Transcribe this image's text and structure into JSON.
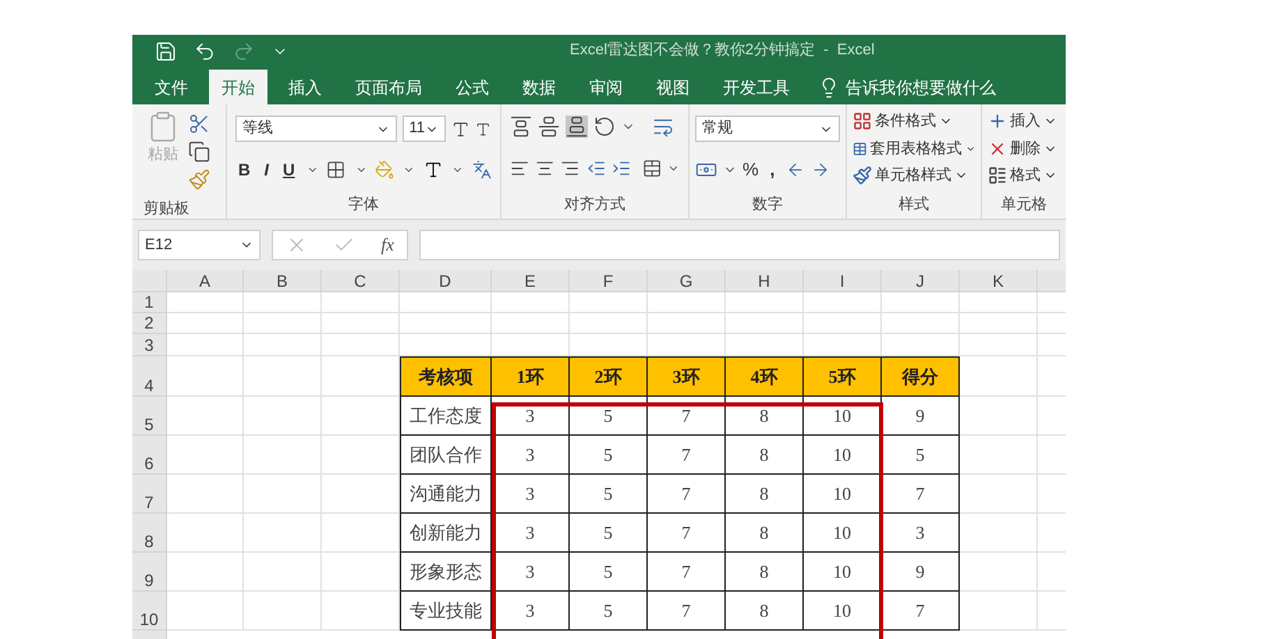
{
  "window": {
    "title": "Excel雷达图不会做？教你2分钟搞定  -  Excel"
  },
  "tabs": [
    {
      "label": "文件",
      "selected": false
    },
    {
      "label": "开始",
      "selected": true
    },
    {
      "label": "插入",
      "selected": false
    },
    {
      "label": "页面布局",
      "selected": false
    },
    {
      "label": "公式",
      "selected": false
    },
    {
      "label": "数据",
      "selected": false
    },
    {
      "label": "审阅",
      "selected": false
    },
    {
      "label": "视图",
      "selected": false
    },
    {
      "label": "开发工具",
      "selected": false
    }
  ],
  "tell_me": "告诉我你想要做什么",
  "ribbon": {
    "clipboard": {
      "label": "剪贴板",
      "paste": "粘贴",
      "paste_disabled": true
    },
    "font": {
      "label": "字体",
      "font_name": "等线",
      "font_size": "11",
      "bold": "B",
      "italic": "I",
      "underline": "U"
    },
    "alignment": {
      "label": "对齐方式"
    },
    "number": {
      "label": "数字",
      "format": "常规",
      "percent": "%",
      "comma": ","
    },
    "styles": {
      "label": "样式",
      "buttons": [
        "条件格式",
        "套用表格格式",
        "单元格样式"
      ]
    },
    "cells": {
      "label": "单元格",
      "buttons": [
        "插入",
        "删除",
        "格式"
      ]
    }
  },
  "formula_bar": {
    "name_box": "E12",
    "fx": "fx"
  },
  "sheet": {
    "columns": [
      "A",
      "B",
      "C",
      "D",
      "E",
      "F",
      "G",
      "H",
      "I",
      "J",
      "K"
    ],
    "rows": [
      "1",
      "2",
      "3",
      "4",
      "5",
      "6",
      "7",
      "8",
      "9",
      "10"
    ],
    "table": {
      "header": [
        "考核项",
        "1环",
        "2环",
        "3环",
        "4环",
        "5环",
        "得分"
      ],
      "rows": [
        [
          "工作态度",
          "3",
          "5",
          "7",
          "8",
          "10",
          "9"
        ],
        [
          "团队合作",
          "3",
          "5",
          "7",
          "8",
          "10",
          "5"
        ],
        [
          "沟通能力",
          "3",
          "5",
          "7",
          "8",
          "10",
          "7"
        ],
        [
          "创新能力",
          "3",
          "5",
          "7",
          "8",
          "10",
          "3"
        ],
        [
          "形象形态",
          "3",
          "5",
          "7",
          "8",
          "10",
          "9"
        ],
        [
          "专业技能",
          "3",
          "5",
          "7",
          "8",
          "10",
          "7"
        ]
      ]
    }
  }
}
